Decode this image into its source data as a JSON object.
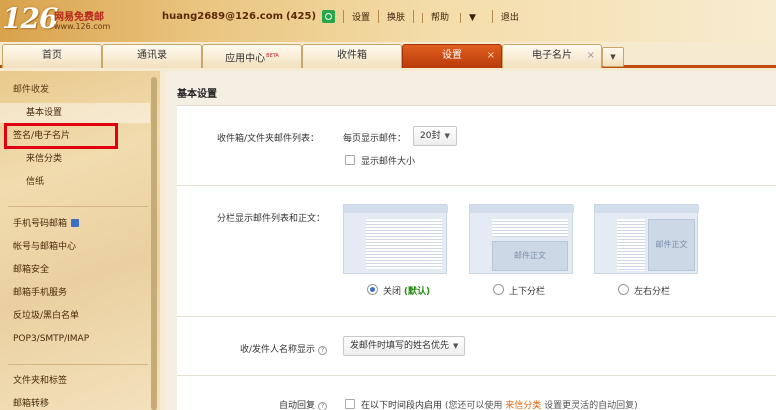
{
  "header": {
    "logo_number": "126",
    "logo_name": "网易免费邮",
    "logo_url": "www.126.com",
    "user_email": "huang2689@126.com",
    "mail_count": "(425)",
    "nav": [
      "设置",
      "换肤",
      "帮助",
      "退出"
    ]
  },
  "tabs": [
    {
      "label": "首页",
      "active": false
    },
    {
      "label": "通讯录",
      "active": false
    },
    {
      "label": "应用中心",
      "badge": "BETA",
      "active": false
    },
    {
      "label": "收件箱",
      "active": false
    },
    {
      "label": "设置",
      "active": true,
      "closable": true
    },
    {
      "label": "电子名片",
      "active": false,
      "closable": true
    }
  ],
  "tab_close_glyph": "×",
  "sidebar": {
    "section1": "邮件收发",
    "items1": [
      "基本设置",
      "签名/电子名片",
      "来信分类",
      "信纸"
    ],
    "items2": [
      "手机号码邮箱",
      "帐号与邮箱中心",
      "邮箱安全",
      "邮箱手机服务",
      "反垃圾/黑白名单",
      "POP3/SMTP/IMAP"
    ],
    "section3": "文件夹和标签",
    "item3": "邮箱转移"
  },
  "main": {
    "title": "基本设置",
    "inbox_label": "收件箱/文件夹邮件列表：",
    "per_page_label": "每页显示邮件：",
    "per_page_value": "20封",
    "show_size": "显示邮件大小",
    "split_label": "分栏显示邮件列表和正文：",
    "preview_text": "邮件正文",
    "options": [
      {
        "label": "关闭",
        "note": "(默认)",
        "selected": true
      },
      {
        "label": "上下分栏",
        "selected": false
      },
      {
        "label": "左右分栏",
        "selected": false
      }
    ],
    "sender_label": "收/发件人名称显示",
    "sender_value": "发邮件时填写的姓名优先",
    "auto_reply_label": "自动回复",
    "auto_reply_text": "在以下时间段内启用",
    "auto_reply_hint": "(您还可以使用",
    "auto_reply_link": "来信分类",
    "auto_reply_tail": "设置更灵活的自动回复)"
  },
  "colors": {
    "accent": "#c24c0e",
    "highlight_box": "#e0000f",
    "selected_radio": "#3a6fc4"
  }
}
